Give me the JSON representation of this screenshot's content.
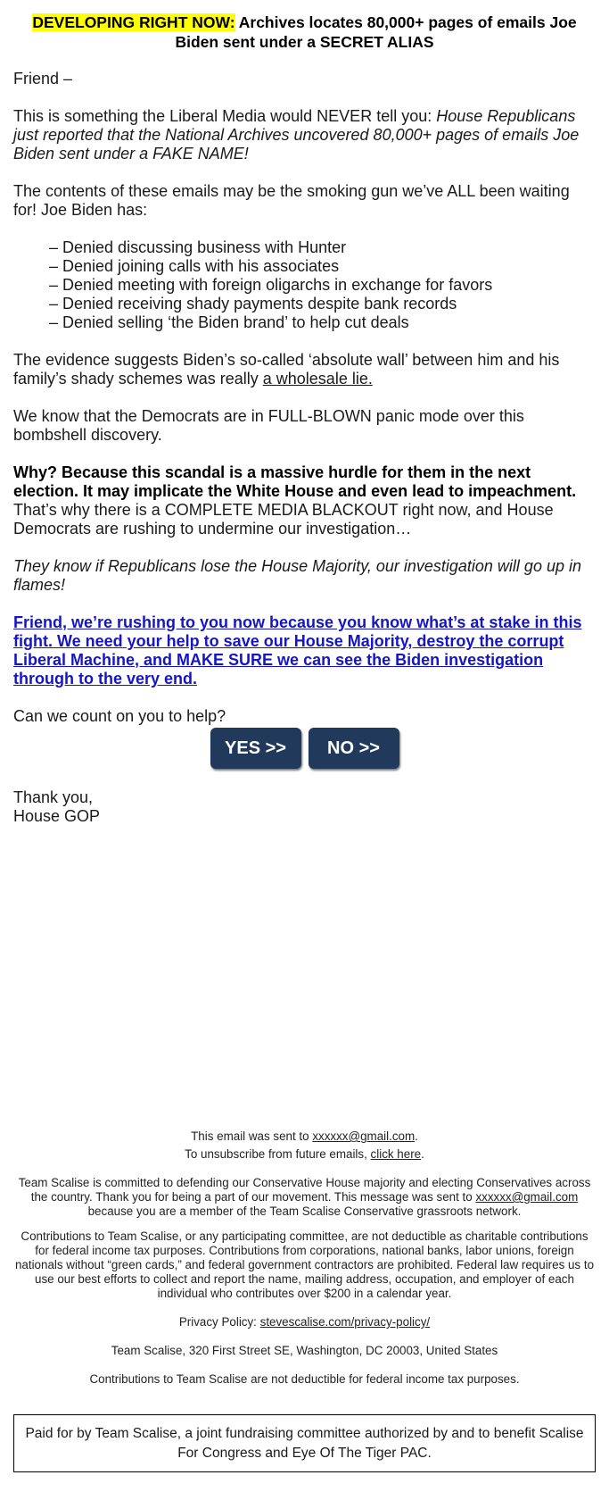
{
  "headline": {
    "highlight": "DEVELOPING RIGHT NOW:",
    "rest_line1": " Archives locates 80,000+ pages of emails Joe Biden sent under a ",
    "emphasis": "SECRET ALIAS",
    "highlight_color": "#ffff00"
  },
  "greeting": "Friend –",
  "intro": {
    "plain": "This is something the Liberal Media would NEVER tell you: ",
    "italic": "House Republicans just reported that the National Archives uncovered 80,000+ pages of emails Joe Biden sent under a FAKE NAME!"
  },
  "contents_para": "The contents of these emails may be the smoking gun we’ve ALL been waiting for! Joe Biden has:",
  "denials": [
    "– Denied discussing business with Hunter",
    "– Denied joining calls with his associates",
    "– Denied meeting with foreign oligarchs in exchange for favors",
    "– Denied receiving shady payments despite bank records",
    "– Denied selling ‘the Biden brand’ to help cut deals"
  ],
  "evidence": {
    "plain": "The evidence suggests Biden’s so-called ‘absolute wall’ between him and his family’s shady schemes was really ",
    "underlined": "a wholesale lie."
  },
  "panic_para": "We know that the Democrats are in FULL-BLOWN panic mode over this bombshell discovery.",
  "why": {
    "bold": "Why? Because this scandal is a massive hurdle for them in the next election. It may implicate the White House and even lead to impeachment.",
    "plain": " That’s why there is a COMPLETE MEDIA BLACKOUT right now, and House Democrats are rushing to undermine our investigation…"
  },
  "flames_para": "They know if Republicans lose the House Majority, our investigation will go up in flames!",
  "cta": {
    "text": "Friend, we’re rushing to you now because you know what’s at stake in this fight. We need your help to save our House Majority, destroy the corrupt Liberal Machine, and MAKE SURE we can see the Biden investigation through to the very end.",
    "color": "#1515c8"
  },
  "question": "Can we count on you to help?",
  "buttons": {
    "yes_label": "YES >>",
    "no_label": "NO >>",
    "color": "#213a5c"
  },
  "signoff": {
    "line1": "Thank you,",
    "line2": "House GOP"
  },
  "footer": {
    "sent_to_prefix": "This email was sent to ",
    "sent_to_email": "xxxxxx@gmail.com",
    "sent_to_suffix": ".",
    "unsubscribe_prefix": "To unsubscribe from future emails, ",
    "unsubscribe_link": "click here",
    "unsubscribe_suffix": ".",
    "commitment_text": "Team Scalise is committed to defending our Conservative House majority and electing Conservatives across the country. Thank you for being a part of our movement. This message was sent to ",
    "commitment_email": "xxxxxx@gmail.com",
    "commitment_suffix": " because you are a member of the Team Scalise Conservative grassroots network.",
    "contributions_text": "Contributions to Team Scalise, or any participating committee, are not deductible as charitable contributions for federal income tax purposes. Contributions from corporations, national banks, labor unions, foreign nationals without “green cards,” and federal government contractors are prohibited. Federal law requires us to use our best efforts to collect and report the name, mailing address, occupation, and employer of each individual who contributes over $200 in a calendar year.",
    "privacy_prefix": "Privacy Policy: ",
    "privacy_link": "stevescalise.com/privacy-policy/",
    "address": "Team Scalise, 320 First Street SE, Washington, DC 20003, United States",
    "tax_note": "Contributions to Team Scalise are not deductible for federal income tax purposes.",
    "paid_for": "Paid for by Team Scalise, a joint fundraising committee authorized by and to benefit Scalise For Congress and Eye Of The Tiger PAC."
  }
}
